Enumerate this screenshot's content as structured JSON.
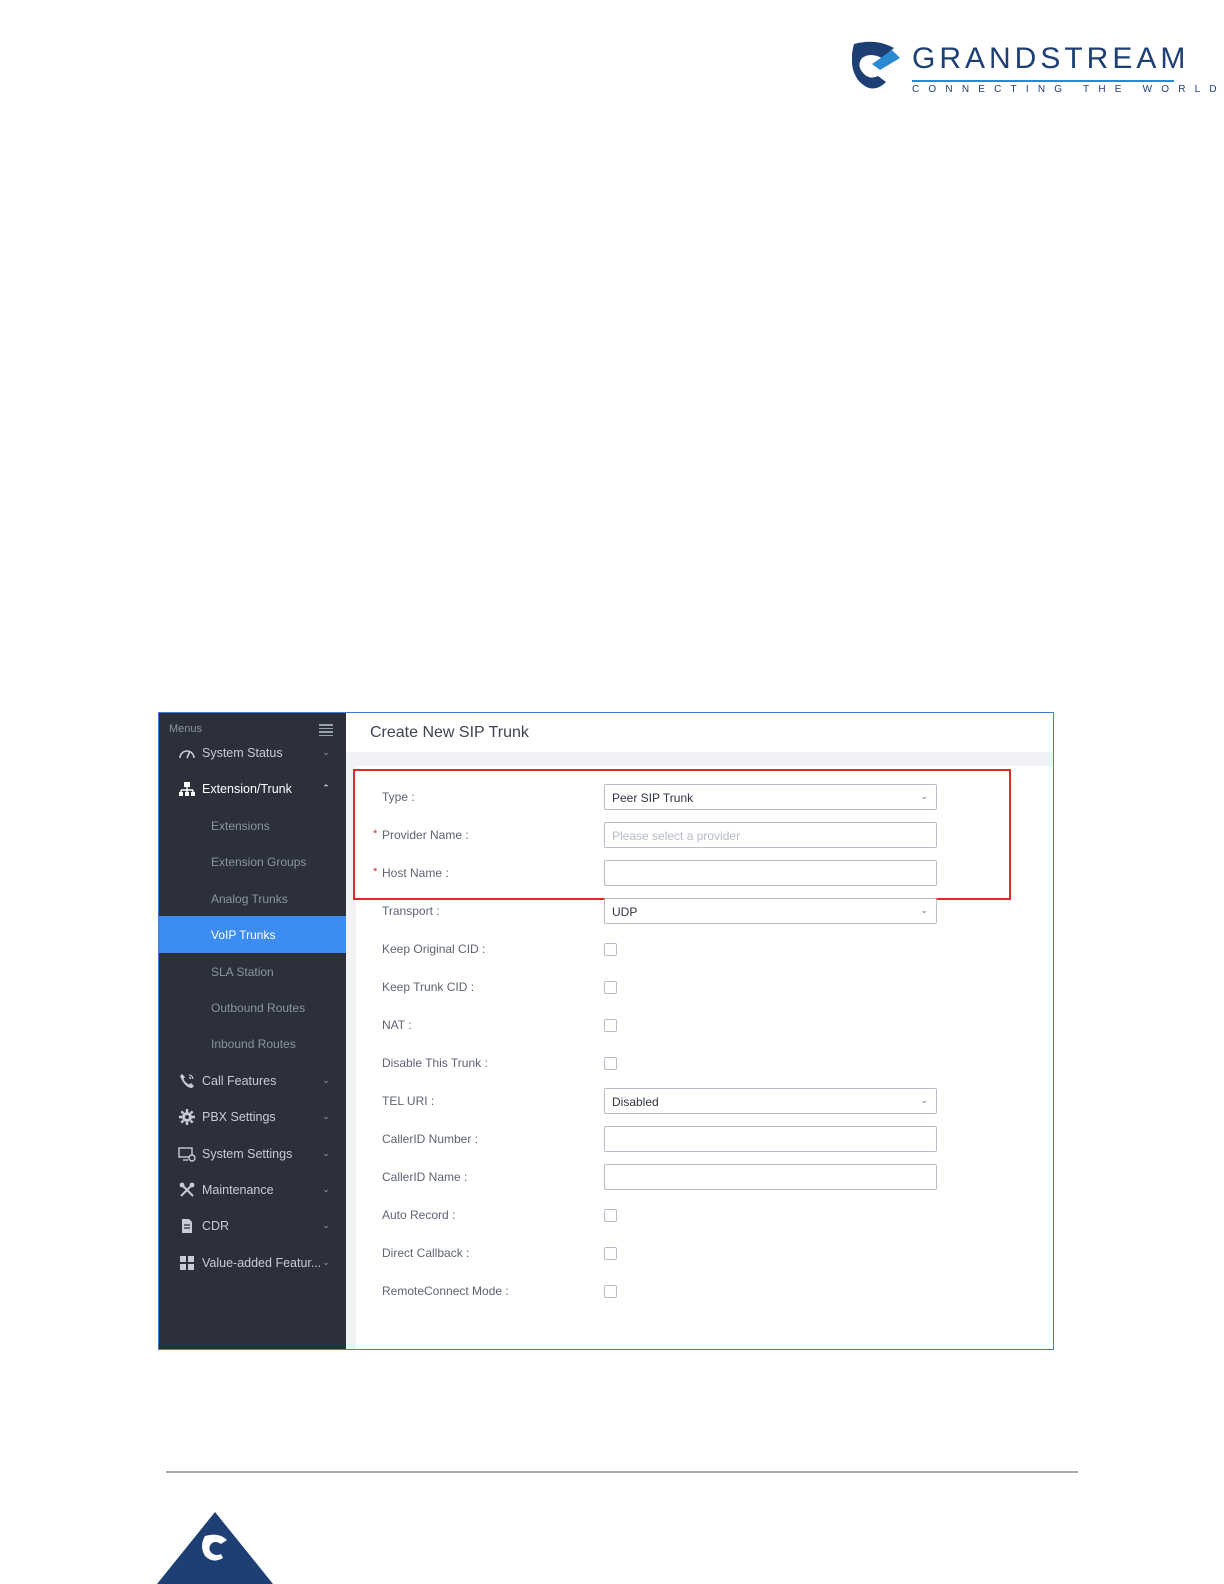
{
  "brand": {
    "name": "GRANDSTREAM",
    "tagline": "CONNECTING THE WORLD",
    "colors": {
      "navy": "#1d3f73",
      "blue": "#2a8ad1"
    }
  },
  "sidebar": {
    "menus_label": "Menus",
    "items": [
      {
        "label": "System Status",
        "icon": "gauge-icon"
      },
      {
        "label": "Extension/Trunk",
        "icon": "network-icon",
        "expanded": true
      },
      {
        "label": "Call Features",
        "icon": "phone-icon"
      },
      {
        "label": "PBX Settings",
        "icon": "gear-icon"
      },
      {
        "label": "System Settings",
        "icon": "system-settings-icon"
      },
      {
        "label": "Maintenance",
        "icon": "tools-icon"
      },
      {
        "label": "CDR",
        "icon": "document-icon"
      },
      {
        "label": "Value-added Featur...",
        "icon": "apps-icon"
      }
    ],
    "subitems": [
      {
        "label": "Extensions"
      },
      {
        "label": "Extension Groups"
      },
      {
        "label": "Analog Trunks"
      },
      {
        "label": "VoIP Trunks",
        "active": true
      },
      {
        "label": "SLA Station"
      },
      {
        "label": "Outbound Routes"
      },
      {
        "label": "Inbound Routes"
      }
    ]
  },
  "main": {
    "title": "Create New SIP Trunk",
    "form": {
      "type": {
        "label": "Type :",
        "value": "Peer SIP Trunk"
      },
      "provider_name": {
        "label": "Provider Name :",
        "placeholder": "Please select a provider",
        "required": "*"
      },
      "host_name": {
        "label": "Host Name :",
        "value": "",
        "required": "*"
      },
      "transport": {
        "label": "Transport :",
        "value": "UDP"
      },
      "keep_original_cid": {
        "label": "Keep Original CID :",
        "checked": false
      },
      "keep_trunk_cid": {
        "label": "Keep Trunk CID :",
        "checked": false
      },
      "nat": {
        "label": "NAT :",
        "checked": false
      },
      "disable_trunk": {
        "label": "Disable This Trunk :",
        "checked": false
      },
      "tel_uri": {
        "label": "TEL URI :",
        "value": "Disabled"
      },
      "callerid_number": {
        "label": "CallerID Number :",
        "value": ""
      },
      "callerid_name": {
        "label": "CallerID Name :",
        "value": ""
      },
      "auto_record": {
        "label": "Auto Record :",
        "checked": false
      },
      "direct_callback": {
        "label": "Direct Callback :",
        "checked": false
      },
      "remoteconnect_mode": {
        "label": "RemoteConnect Mode :",
        "checked": false
      }
    }
  }
}
